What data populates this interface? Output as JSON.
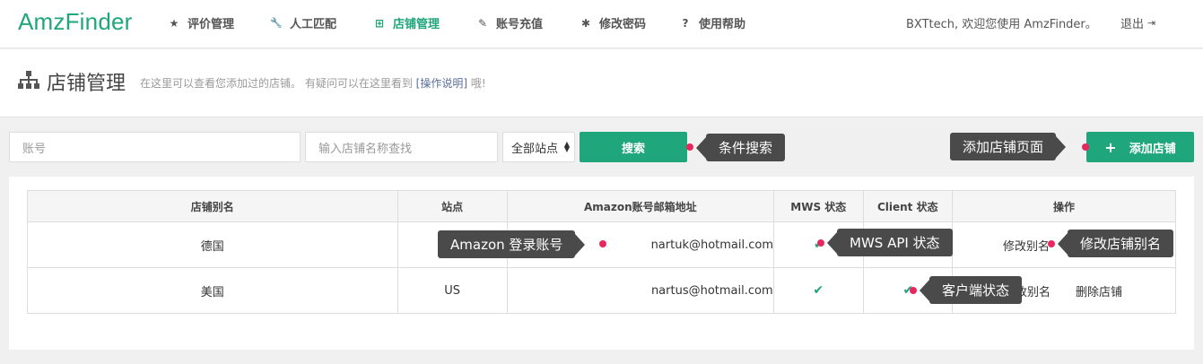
{
  "brand": "AmzFinder",
  "nav": {
    "items": [
      {
        "icon": "★",
        "label": "评价管理"
      },
      {
        "icon": "🔧",
        "label": "人工匹配"
      },
      {
        "icon": "⊞",
        "label": "店铺管理"
      },
      {
        "icon": "✎",
        "label": "账号充值"
      },
      {
        "icon": "✱",
        "label": "修改密码"
      },
      {
        "icon": "?",
        "label": "使用帮助"
      }
    ],
    "welcome": "BXTtech, 欢迎您使用 AmzFinder。",
    "logout": "退出"
  },
  "page_header": {
    "title": "店铺管理",
    "desc_prefix": "在这里可以查看您添加过的店铺。 有疑问可以在这里看到 ",
    "desc_link": "[操作说明]",
    "desc_suffix": " 哦!"
  },
  "toolbar": {
    "account_placeholder": "账号",
    "store_placeholder": "输入店铺名称查找",
    "site_select": "全部站点",
    "search_button": "搜索",
    "add_button": "添加店铺",
    "add_icon": "+"
  },
  "tooltips": {
    "search": "条件搜索",
    "add_page": "添加店铺页面",
    "amazon_login": "Amazon 登录账号",
    "mws_api": "MWS API 状态",
    "rename": "修改店铺别名",
    "client": "客户端状态"
  },
  "table": {
    "headers": [
      "店铺别名",
      "站点",
      "Amazon账号邮箱地址",
      "MWS 状态",
      "Client 状态",
      "操作"
    ],
    "rows": [
      {
        "alias": "德国",
        "site": "",
        "email": "nartuk@hotmail.com",
        "mws": "✔",
        "client": "",
        "rename": "修改别名",
        "delete": ""
      },
      {
        "alias": "美国",
        "site": "US",
        "email": "nartus@hotmail.com",
        "mws": "✔",
        "client": "✔",
        "rename": "改别名",
        "delete": "删除店铺"
      }
    ]
  },
  "colors": {
    "accent": "#1fa67a",
    "tooltip_bg": "#4a4a4a",
    "dot": "#e8275e"
  }
}
